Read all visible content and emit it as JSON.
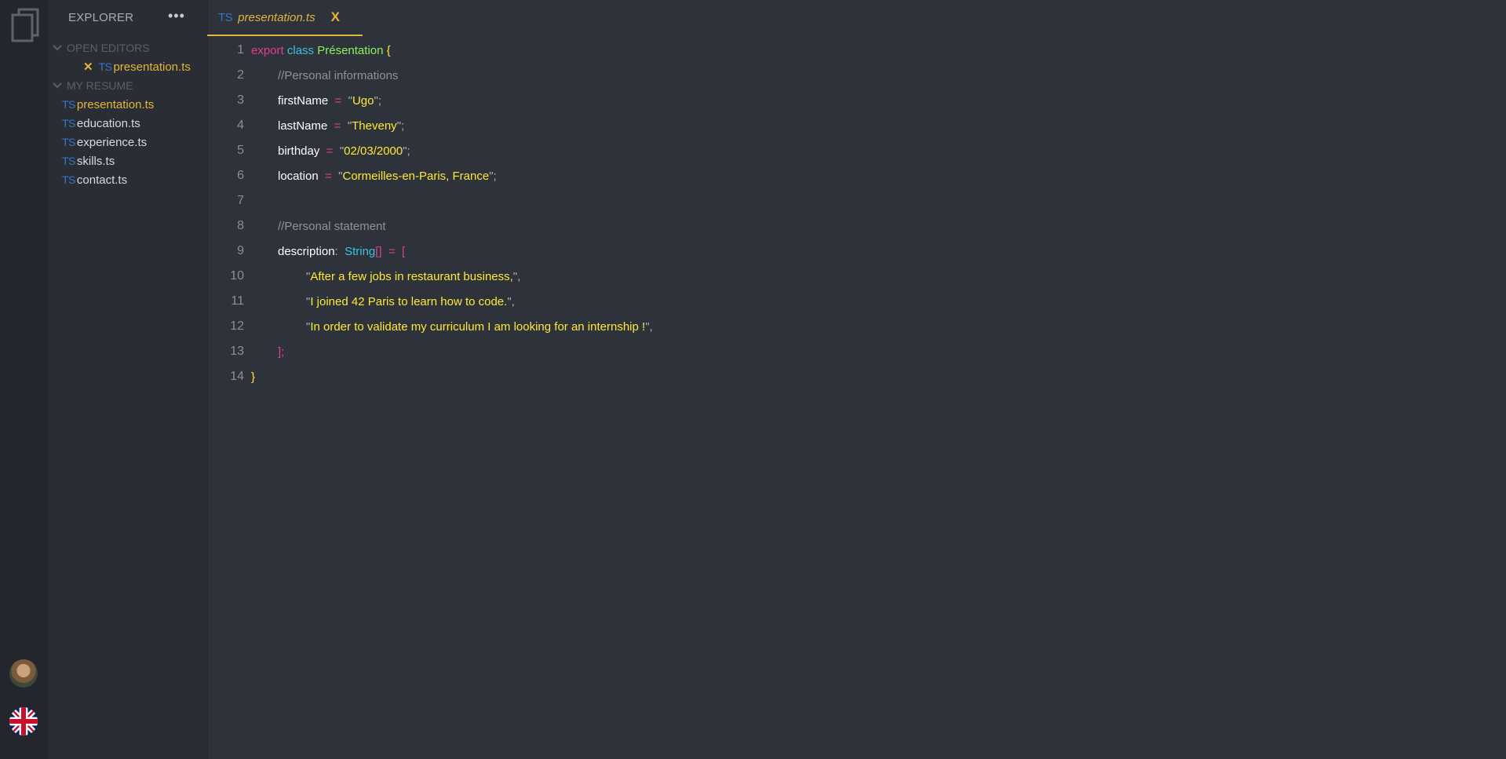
{
  "sidebar": {
    "title": "EXPLORER",
    "more": "•••",
    "open_editors_label": "OPEN EDITORS",
    "open_editors": [
      {
        "ext": "TS",
        "name": "presentation.ts"
      }
    ],
    "resume_label": "MY RESUME",
    "files": [
      {
        "ext": "TS",
        "name": "presentation.ts"
      },
      {
        "ext": "TS",
        "name": "education.ts"
      },
      {
        "ext": "TS",
        "name": "experience.ts"
      },
      {
        "ext": "TS",
        "name": "skills.ts"
      },
      {
        "ext": "TS",
        "name": "contact.ts"
      }
    ]
  },
  "tab": {
    "ext": "TS",
    "name": "presentation.ts",
    "close": "X"
  },
  "editor": {
    "line_numbers": [
      "1",
      "2",
      "3",
      "4",
      "5",
      "6",
      "7",
      "8",
      "9",
      "10",
      "11",
      "12",
      "13",
      "14"
    ],
    "l1": {
      "export": "export",
      "class": "class",
      "name": "Présentation",
      "brace": "{"
    },
    "l2": {
      "comment": "//Personal informations"
    },
    "l3": {
      "prop": "firstName",
      "op": "=",
      "value": "Ugo"
    },
    "l4": {
      "prop": "lastName",
      "op": "=",
      "value": "Theveny"
    },
    "l5": {
      "prop": "birthday",
      "op": "=",
      "value": "02/03/2000"
    },
    "l6": {
      "prop": "location",
      "op": "=",
      "value": "Cormeilles-en-Paris, France"
    },
    "l8": {
      "comment": "//Personal statement"
    },
    "l9": {
      "prop": "description",
      "colon": ":",
      "type": "String",
      "brackets": "[]",
      "op": "=",
      "open": "["
    },
    "l10": {
      "value": "After a few jobs in restaurant business,"
    },
    "l11": {
      "value": "I joined 42 Paris to learn how to code."
    },
    "l12": {
      "value": "In order to validate my curriculum I am looking for an internship !"
    },
    "l13": {
      "close": "];"
    },
    "l14": {
      "brace": "}"
    }
  },
  "icons": [
    "files-icon",
    "avatar",
    "uk-flag-icon",
    "chevron-down-icon",
    "close-icon"
  ],
  "colors": {
    "accent": "#e5b53b",
    "keyword": "#e03f8f",
    "class": "#39c3e0",
    "string": "#ffe837",
    "ts": "#3178c6"
  }
}
